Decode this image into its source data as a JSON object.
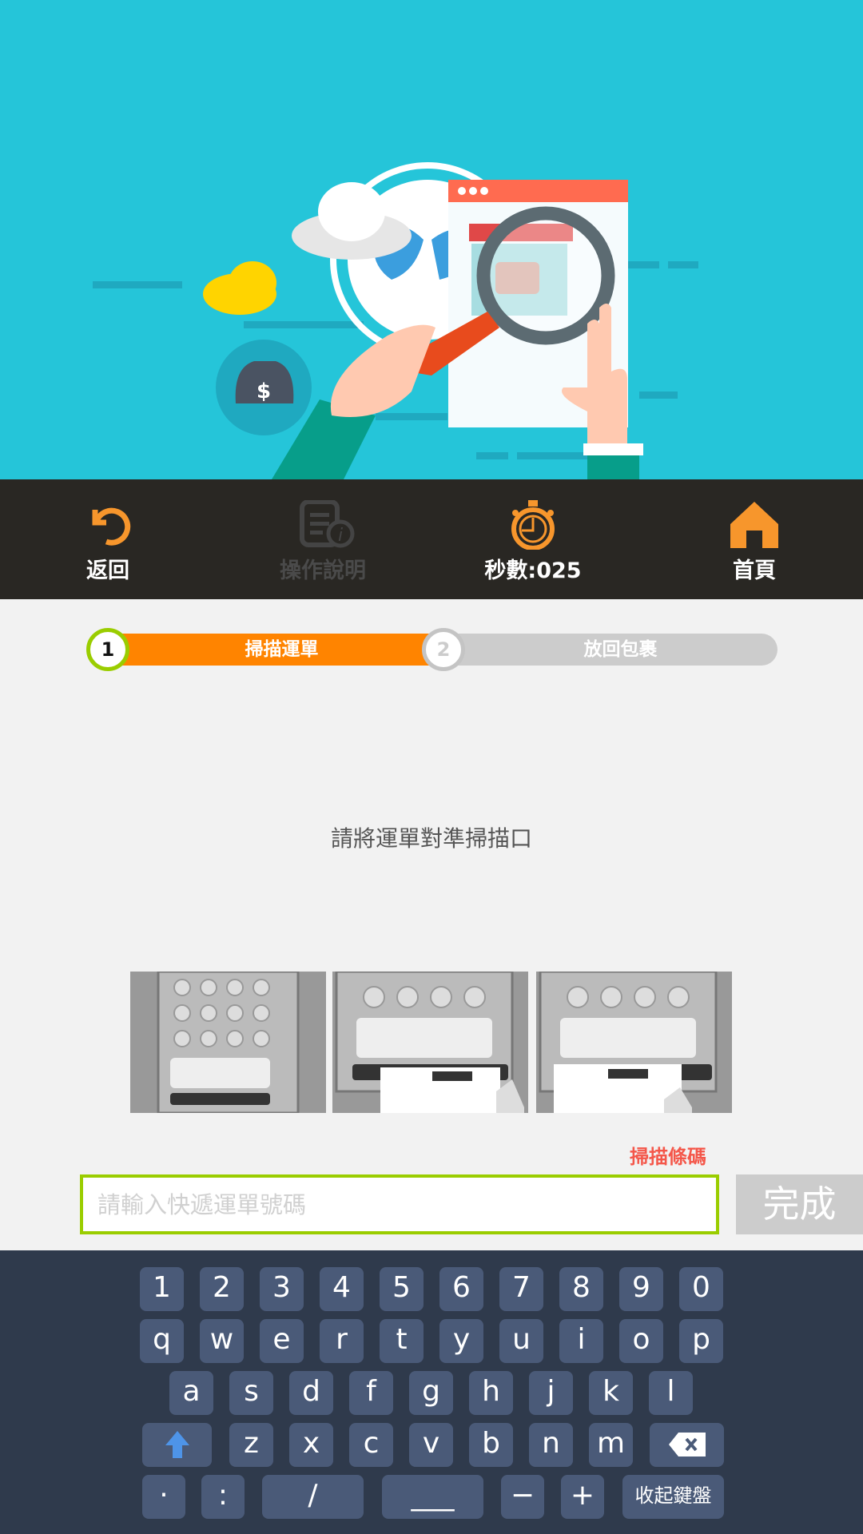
{
  "nav": {
    "back": "返回",
    "help": "操作說明",
    "timer": "秒數:025",
    "home": "首頁"
  },
  "steps": [
    {
      "num": "1",
      "label": "掃描運單"
    },
    {
      "num": "2",
      "label": "放回包裹"
    }
  ],
  "instruction": "請將運單對準掃描口",
  "scan_label": "掃描條碼",
  "input": {
    "placeholder": "請輸入快遞運單號碼",
    "value": ""
  },
  "done_label": "完成",
  "keyboard": {
    "row1": [
      "1",
      "2",
      "3",
      "4",
      "5",
      "6",
      "7",
      "8",
      "9",
      "0"
    ],
    "row2": [
      "q",
      "w",
      "e",
      "r",
      "t",
      "y",
      "u",
      "i",
      "o",
      "p"
    ],
    "row3": [
      "a",
      "s",
      "d",
      "f",
      "g",
      "h",
      "j",
      "k",
      "l"
    ],
    "row4": [
      "z",
      "x",
      "c",
      "v",
      "b",
      "n",
      "m"
    ],
    "row5": [
      "·",
      ":",
      "/",
      "___",
      "−",
      "+"
    ],
    "hide_label": "收起鍵盤"
  },
  "colors": {
    "accent": "#f7962c",
    "step_active": "#ff8400",
    "step_inactive": "#cccccc",
    "input_border": "#9acd00",
    "scan_label": "#f4574a"
  }
}
